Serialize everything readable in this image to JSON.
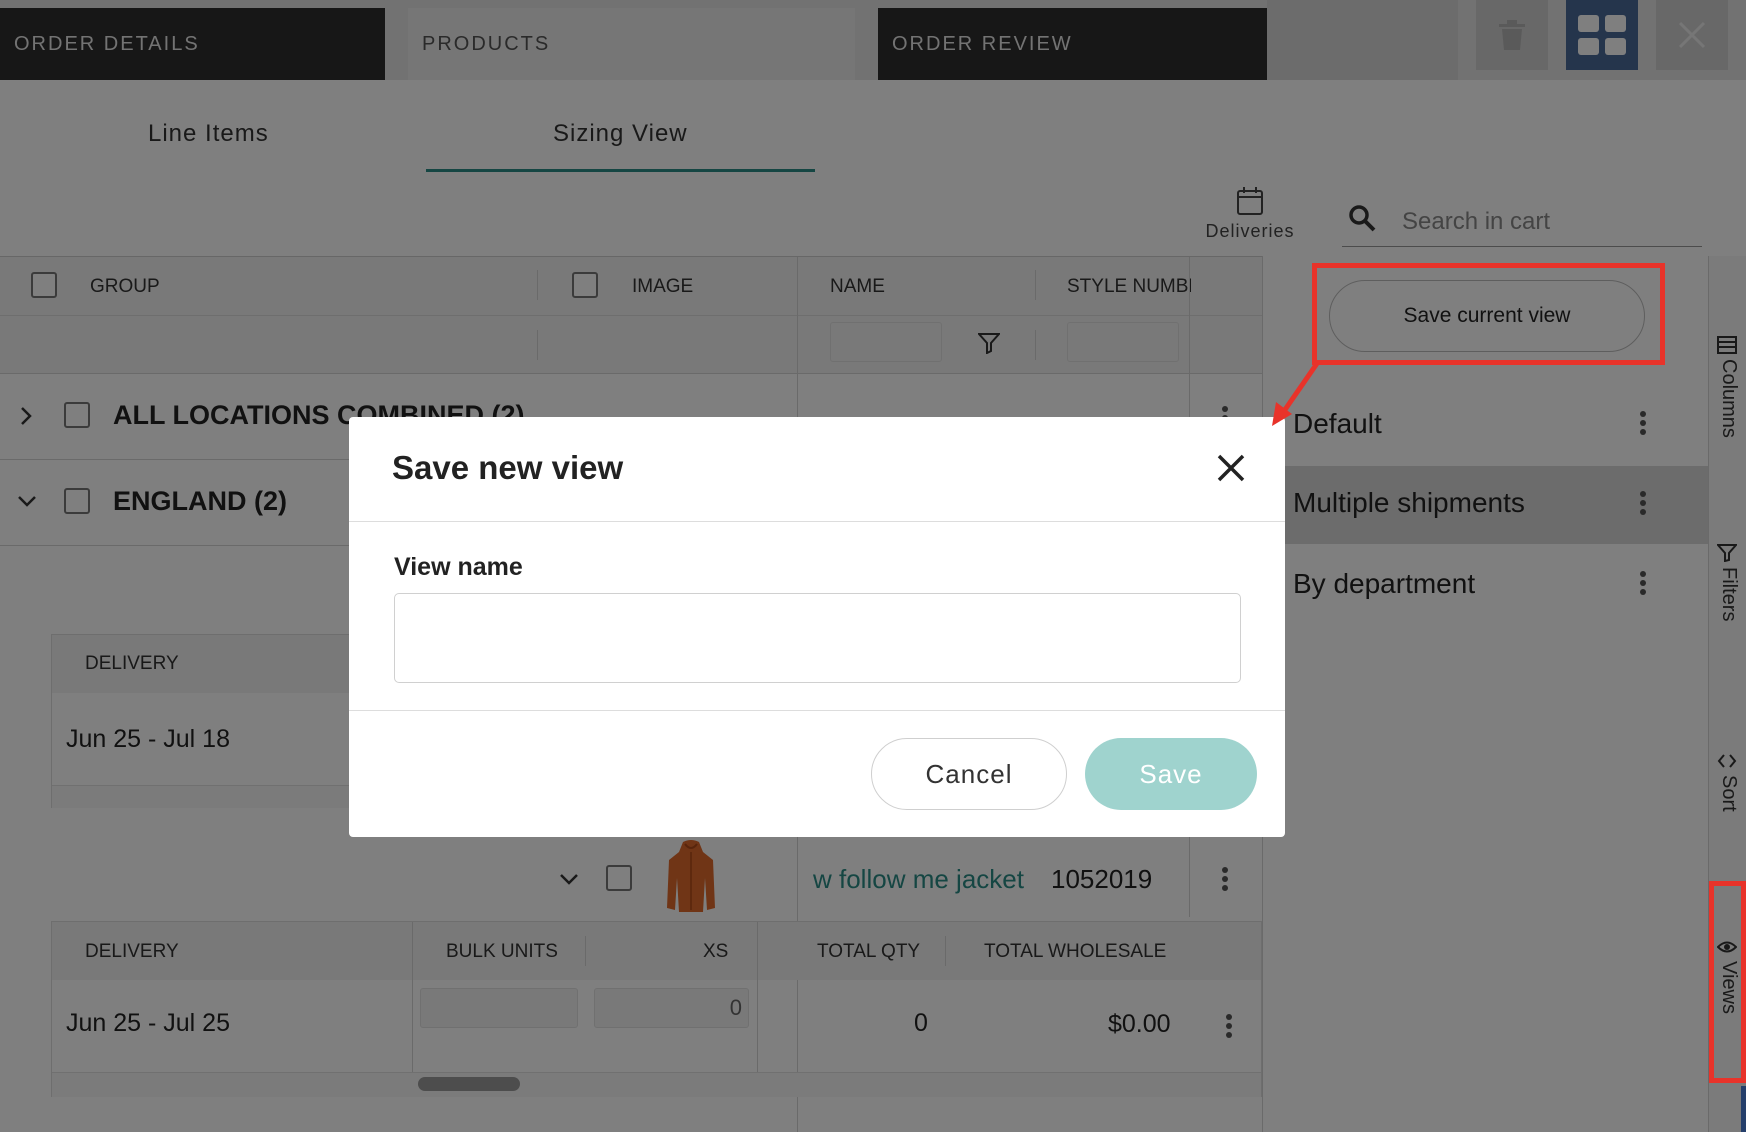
{
  "steps": [
    "ORDER DETAILS",
    "PRODUCTS",
    "ORDER REVIEW"
  ],
  "sub_tabs": [
    "Line Items",
    "Sizing View"
  ],
  "deliveries_label": "Deliveries",
  "search": {
    "placeholder": "Search in cart"
  },
  "grid": {
    "headers": [
      "GROUP",
      "IMAGE",
      "NAME",
      "STYLE NUMBE"
    ],
    "groups": [
      "ALL LOCATIONS COMBINED (2)",
      "ENGLAND (2)"
    ],
    "sub_table_1": {
      "headers": [
        "DELIVERY"
      ],
      "row": {
        "delivery": "Jun 25 - Jul 18"
      }
    },
    "product": {
      "name": "w follow me jacket",
      "style_number": "1052019"
    },
    "sub_table_2": {
      "headers": [
        "DELIVERY",
        "BULK UNITS",
        "XS",
        "TOTAL QTY",
        "TOTAL WHOLESALE"
      ],
      "row": {
        "delivery": "Jun 25 - Jul 25",
        "xs": "0",
        "total_qty": "0",
        "total_wholesale": "$0.00"
      }
    }
  },
  "views_panel": {
    "save_current_view": "Save current view",
    "views": [
      "Default",
      "Multiple shipments",
      "By department"
    ]
  },
  "side_tabs": [
    "Columns",
    "Filters",
    "Sort",
    "Views"
  ],
  "modal": {
    "title": "Save new view",
    "field_label": "View name",
    "field_value": "",
    "cancel": "Cancel",
    "save": "Save"
  },
  "colors": {
    "accent_teal": "#2a8c86",
    "save_button": "#9fd3ce",
    "annotation_red": "#e8332a",
    "dark_tab": "#2f2f2f"
  }
}
